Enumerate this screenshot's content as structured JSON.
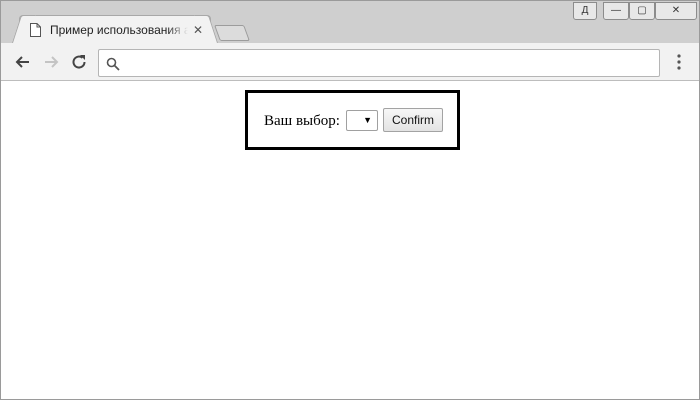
{
  "browser": {
    "tab_title": "Пример использования атрибута",
    "tab_close_glyph": "✕",
    "profile_glyph": "Д",
    "window_controls": {
      "minimize": "—",
      "maximize": "▢",
      "close": "✕"
    },
    "address_value": "",
    "address_placeholder": ""
  },
  "page": {
    "field_label": "Ваш выбор:",
    "select_value": "",
    "select_arrow": "▼",
    "confirm_label": "Confirm"
  },
  "icons": {
    "tab": "page-icon",
    "back": "arrow-left-icon",
    "forward": "arrow-right-icon",
    "reload": "reload-icon",
    "search": "search-icon",
    "menu": "kebab-menu-icon"
  }
}
